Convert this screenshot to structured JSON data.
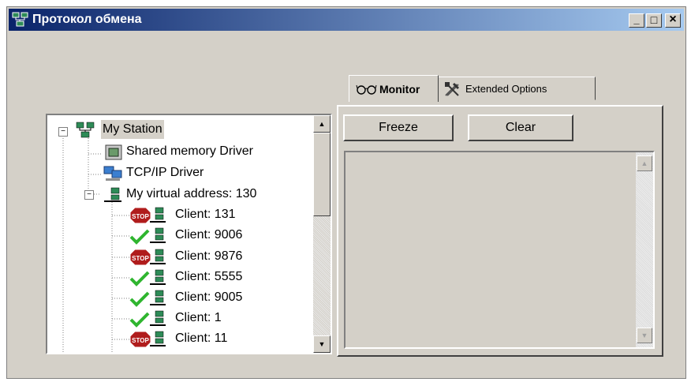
{
  "window": {
    "title": "Протокол обмена",
    "minimize": "_",
    "maximize": "□",
    "close": "×"
  },
  "tabs": [
    {
      "label": "Monitor",
      "icon": "glasses-icon",
      "active": true
    },
    {
      "label": "Extended Options",
      "icon": "tools-icon",
      "active": false
    }
  ],
  "buttons": {
    "freeze": "Freeze",
    "clear": "Clear"
  },
  "tree": {
    "root": "My Station",
    "drivers": [
      "Shared memory Driver",
      "TCP/IP Driver"
    ],
    "virtual_address": "My virtual address: 130",
    "clients": [
      {
        "label": "Client: 131",
        "status": "stop"
      },
      {
        "label": "Client: 9006",
        "status": "ok"
      },
      {
        "label": "Client: 9876",
        "status": "stop"
      },
      {
        "label": "Client: 5555",
        "status": "ok"
      },
      {
        "label": "Client: 9005",
        "status": "ok"
      },
      {
        "label": "Client: 1",
        "status": "ok"
      },
      {
        "label": "Client: 11",
        "status": "stop"
      }
    ],
    "stop_badge": "STOP"
  },
  "colors": {
    "title_start": "#0a246a",
    "title_end": "#a6caf0",
    "stop": "#b01c1c",
    "ok": "#2fb52f"
  }
}
